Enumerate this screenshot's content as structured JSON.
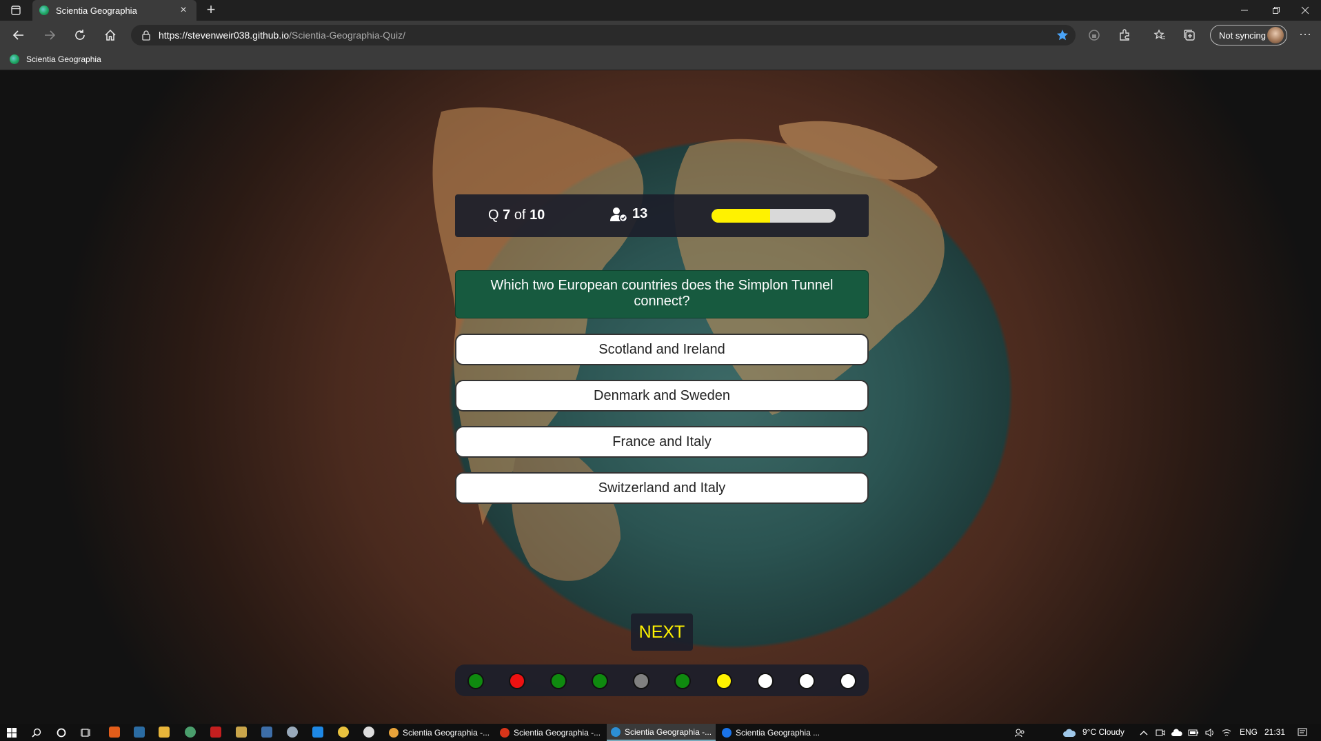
{
  "browser": {
    "tab_title": "Scientia Geographia",
    "tab_close": "×",
    "new_tab": "+",
    "url_host": "https://stevenweir038.github.io",
    "url_path": "/Scientia-Geographia-Quiz/",
    "sync_label": "Not syncing",
    "more_label": "···",
    "favorites": [
      {
        "label": "Scientia Geographia"
      }
    ]
  },
  "quiz": {
    "q_prefix": "Q",
    "q_current": "7",
    "q_of": "of",
    "q_total": "10",
    "score": "13",
    "progress_fraction": 0.47,
    "question": "Which two European countries does the Simplon Tunnel connect?",
    "answers": [
      "Scotland and Ireland",
      "Denmark and Sweden",
      "France and Italy",
      "Switzerland and Italy"
    ],
    "next_label": "NEXT",
    "tracker": [
      {
        "state": "correct",
        "color": "#0f8a0f"
      },
      {
        "state": "wrong",
        "color": "#ee1111"
      },
      {
        "state": "correct",
        "color": "#0f8a0f"
      },
      {
        "state": "correct",
        "color": "#0f8a0f"
      },
      {
        "state": "skipped",
        "color": "#808080"
      },
      {
        "state": "correct",
        "color": "#0f8a0f"
      },
      {
        "state": "current",
        "color": "#fff200"
      },
      {
        "state": "pending",
        "color": "#ffffff"
      },
      {
        "state": "pending",
        "color": "#ffffff"
      },
      {
        "state": "pending",
        "color": "#ffffff"
      }
    ]
  },
  "taskbar": {
    "tasks": [
      {
        "label": "Scientia Geographia -...",
        "icon_color": "#e8a33a",
        "active": false
      },
      {
        "label": "Scientia Geographia -...",
        "icon_color": "#d9351a",
        "active": false
      },
      {
        "label": "Scientia Geographia -...",
        "icon_color": "#2c8fd6",
        "active": true
      },
      {
        "label": "Scientia Geographia ...",
        "icon_color": "#1a73e8",
        "active": false
      }
    ],
    "weather": "9°C  Cloudy",
    "language": "ENG",
    "time": "21:31"
  },
  "colors": {
    "accent_yellow": "#fff200",
    "question_bg": "#175a3f",
    "panel_bg": "#1c1e2a"
  }
}
